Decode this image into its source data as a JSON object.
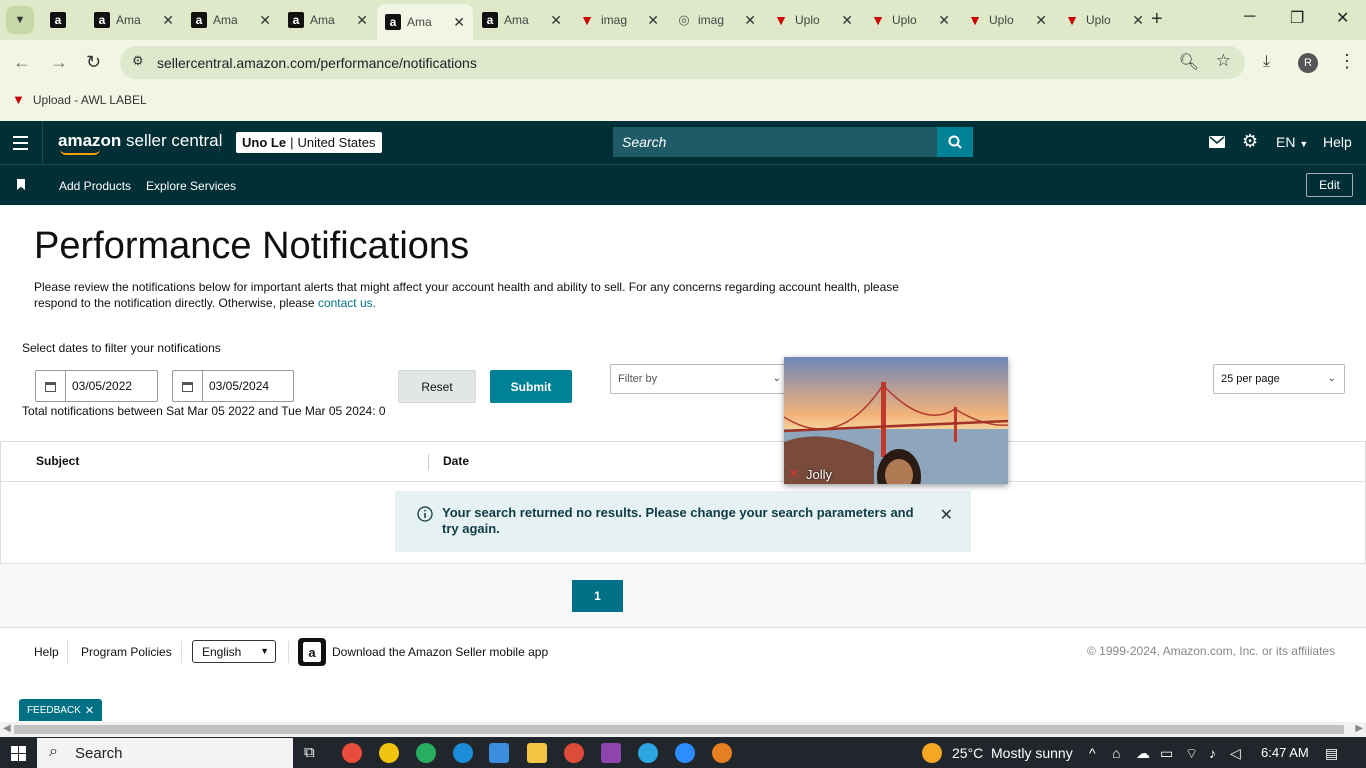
{
  "browser": {
    "tabs": [
      {
        "title": "",
        "icon": "amazon"
      },
      {
        "title": "Ama",
        "icon": "amazon"
      },
      {
        "title": "Ama",
        "icon": "amazon"
      },
      {
        "title": "Ama",
        "icon": "amazon"
      },
      {
        "title": "Ama",
        "icon": "amazon",
        "active": true
      },
      {
        "title": "Ama",
        "icon": "amazon"
      },
      {
        "title": "imag",
        "icon": "awl"
      },
      {
        "title": "imag",
        "icon": "globe"
      },
      {
        "title": "Uplo",
        "icon": "awl"
      },
      {
        "title": "Uplo",
        "icon": "awl"
      },
      {
        "title": "Uplo",
        "icon": "awl"
      },
      {
        "title": "Uplo",
        "icon": "awl"
      }
    ],
    "url": "sellercentral.amazon.com/performance/notifications",
    "profile_initial": "R",
    "bookmark": "Upload - AWL LABEL"
  },
  "header": {
    "logo_brand": "amazon",
    "logo_product": "seller central",
    "account_name": "Uno Le",
    "account_region": "United States",
    "search_placeholder": "Search",
    "language": "EN",
    "help": "Help",
    "nav_links": [
      "Add Products",
      "Explore Services"
    ],
    "edit_label": "Edit"
  },
  "page": {
    "title": "Performance Notifications",
    "intro": "Please review the notifications below for important alerts that might affect your account health and ability to sell. For any concerns regarding account health, please respond to the notification directly. Otherwise, please",
    "intro_link": "contact us.",
    "filter_label": "Select dates to filter your notifications",
    "start_date": "03/05/2022",
    "end_date": "03/05/2024",
    "reset_label": "Reset",
    "submit_label": "Submit",
    "filter_by_placeholder": "Filter by",
    "per_page": "25 per page",
    "total_text": "Total notifications between Sat Mar 05 2022 and Tue Mar 05 2024: 0",
    "columns": [
      "Subject",
      "Date"
    ],
    "no_results": "Your search returned no results. Please change your search parameters and try again.",
    "current_page": "1"
  },
  "footer": {
    "help": "Help",
    "program_policies": "Program Policies",
    "language": "English",
    "app_download": "Download the Amazon Seller mobile app",
    "copyright": "© 1999-2024, Amazon.com, Inc. or its affiliates",
    "feedback": "FEEDBACK"
  },
  "video_overlay": {
    "participant": "Jolly"
  },
  "taskbar": {
    "search": "Search",
    "temperature": "25°C",
    "weather": "Mostly sunny",
    "time": "6:47 AM"
  },
  "colors": {
    "header_bg": "#002f36",
    "accent": "#008296",
    "link": "#007185",
    "tab_strip": "#dfe9c9"
  }
}
